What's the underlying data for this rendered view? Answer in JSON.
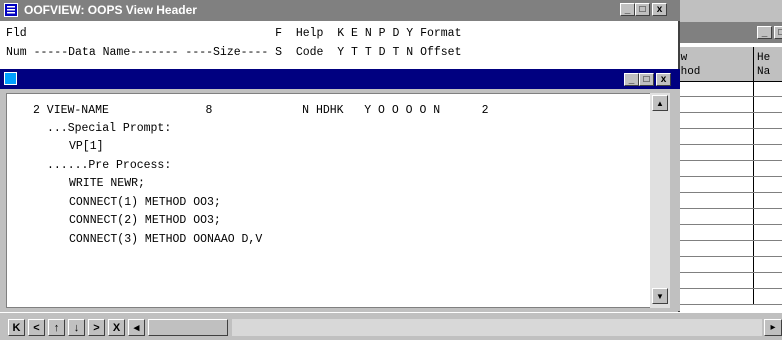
{
  "main_window": {
    "title": "OOFVIEW: OOPS View Header"
  },
  "header": {
    "line1": "Fld                                    F  Help  K E N P D Y Format",
    "line2": "Num -----Data Name------- ----Size---- S  Code  Y T T D T N Offset"
  },
  "background_window": {
    "col1_line1": "ew",
    "col1_line2": "thod",
    "col2_line1": "He",
    "col2_line2": "Na"
  },
  "record": {
    "line1": "2 VIEW-NAME              8             N HDHK   Y O O O O N      2",
    "line2": "...Special Prompt:",
    "line3": "VP[1]",
    "line4": "......Pre Process:",
    "line5": "WRITE NEWR;",
    "line6": "CONNECT(1) METHOD OO3;",
    "line7": "CONNECT(2) METHOD OO3;",
    "line8": "CONNECT(3) METHOD OONAAO D,V"
  },
  "nav": {
    "first": "K",
    "prev_page": "<",
    "up": "↑",
    "down": "↓",
    "next_page": ">",
    "last": "X",
    "scroll_left": "◂",
    "scroll_right": "▸"
  },
  "window_buttons": {
    "minimize": "_",
    "maximize": "□",
    "close": "x"
  }
}
